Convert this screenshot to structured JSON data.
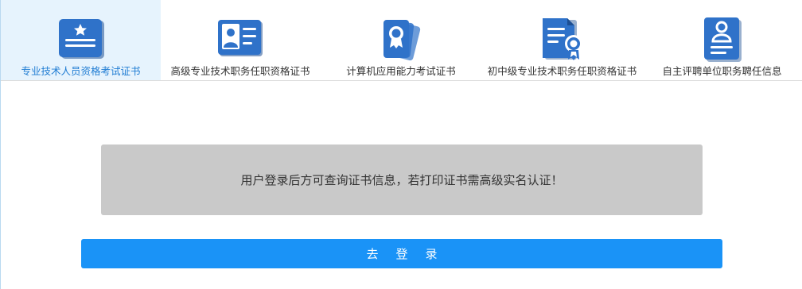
{
  "tabs": [
    {
      "label": "专业技术人员资格考试证书",
      "icon": "certificate-star-icon",
      "active": true
    },
    {
      "label": "高级专业技术职务任职资格证书",
      "icon": "id-card-icon",
      "active": false
    },
    {
      "label": "计算机应用能力考试证书",
      "icon": "award-badge-icon",
      "active": false
    },
    {
      "label": "初中级专业技术职务任职资格证书",
      "icon": "document-seal-icon",
      "active": false
    },
    {
      "label": "自主评聘单位职务聘任信息",
      "icon": "user-document-icon",
      "active": false
    }
  ],
  "notice": {
    "text": "用户登录后方可查询证书信息，若打印证书需高级实名认证！"
  },
  "login_button": {
    "label": "去登录"
  },
  "colors": {
    "icon_blue": "#2f72c9",
    "active_tab_bg": "#e6f3fd",
    "active_tab_text": "#1f7cd3",
    "notice_bg": "#c9c9c9",
    "button_bg": "#1a93f7"
  }
}
